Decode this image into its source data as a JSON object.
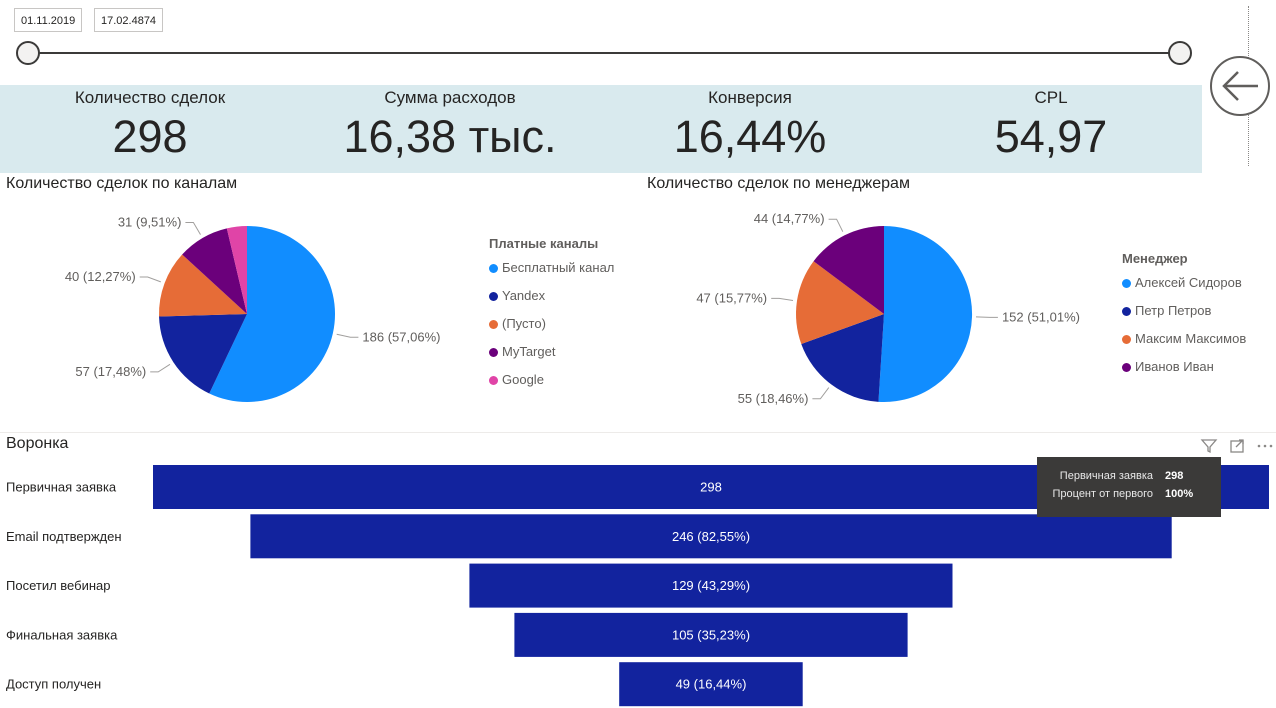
{
  "slicer": {
    "start_date": "01.11.2019",
    "end_date": "17.02.4874"
  },
  "kpis": [
    {
      "label": "Количество сделок",
      "value": "298"
    },
    {
      "label": "Сумма расходов",
      "value": "16,38 тыс."
    },
    {
      "label": "Конверсия",
      "value": "16,44%"
    },
    {
      "label": "CPL",
      "value": "54,97"
    }
  ],
  "channels": {
    "title": "Количество сделок по каналам",
    "legend_title": "Платные каналы"
  },
  "managers": {
    "title": "Количество сделок по менеджерам",
    "legend_title": "Менеджер"
  },
  "funnel": {
    "title": "Воронка"
  },
  "tooltip": {
    "rows": [
      {
        "label": "Первичная заявка",
        "value": "298"
      },
      {
        "label": "Процент от первого",
        "value": "100%"
      }
    ]
  },
  "chart_data": [
    {
      "type": "pie",
      "title": "Количество сделок по каналам",
      "legend_title": "Платные каналы",
      "legend_position": "right",
      "slices": [
        {
          "name": "Бесплатный канал",
          "value": 186,
          "label": "186 (57,06%)",
          "color": "#118dff"
        },
        {
          "name": "Yandex",
          "value": 57,
          "label": "57 (17,48%)",
          "color": "#12239e"
        },
        {
          "name": "(Пусто)",
          "value": 40,
          "label": "40 (12,27%)",
          "color": "#e66c37"
        },
        {
          "name": "MyTarget",
          "value": 31,
          "label": "31 (9,51%)",
          "color": "#6b007b"
        },
        {
          "name": "Google",
          "value": 12,
          "label": "",
          "color": "#e044a7"
        }
      ]
    },
    {
      "type": "pie",
      "title": "Количество сделок по менеджерам",
      "legend_title": "Менеджер",
      "legend_position": "right",
      "slices": [
        {
          "name": "Алексей Сидоров",
          "value": 152,
          "label": "152 (51,01%)",
          "color": "#118dff"
        },
        {
          "name": "Петр Петров",
          "value": 55,
          "label": "55 (18,46%)",
          "color": "#12239e"
        },
        {
          "name": "Максим Максимов",
          "value": 47,
          "label": "47 (15,77%)",
          "color": "#e66c37"
        },
        {
          "name": "Иванов Иван",
          "value": 44,
          "label": "44 (14,77%)",
          "color": "#6b007b"
        }
      ]
    },
    {
      "type": "bar",
      "subtype": "funnel",
      "title": "Воронка",
      "color": "#12239e",
      "categories": [
        "Первичная заявка",
        "Email подтвержден",
        "Посетил вебинар",
        "Финальная заявка",
        "Доступ получен"
      ],
      "values": [
        298,
        246,
        129,
        105,
        49
      ],
      "labels": [
        "298",
        "246 (82,55%)",
        "129 (43,29%)",
        "105 (35,23%)",
        "49 (16,44%)"
      ]
    }
  ]
}
